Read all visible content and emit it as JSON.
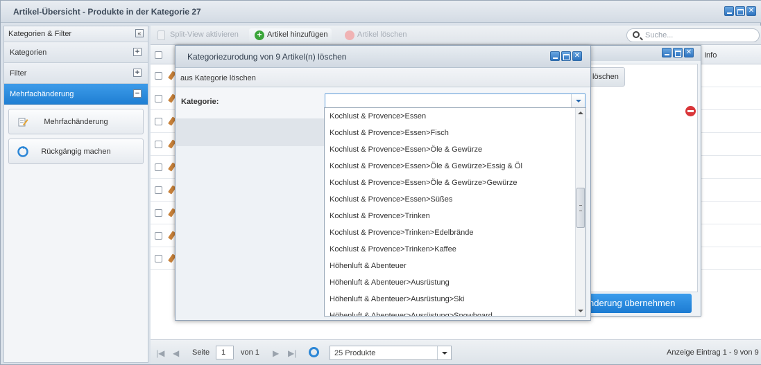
{
  "window": {
    "title": "Artikel-Übersicht - Produkte in der Kategorie 27"
  },
  "sidebar": {
    "header": "Kategorien & Filter",
    "sections": [
      "Kategorien",
      "Filter",
      "Mehrfachänderung"
    ],
    "actions": [
      "Mehrfachänderung",
      "Rückgängig machen"
    ]
  },
  "toolbar": {
    "split_view": "Split-View aktivieren",
    "add": "Artikel hinzufügen",
    "delete": "Artikel löschen",
    "search_placeholder": "Suche..."
  },
  "grid": {
    "col_info": "Info",
    "row_count": 9
  },
  "pager": {
    "page_label": "Seite",
    "page_value": "1",
    "of_label": "von 1",
    "page_size": "25 Produkte",
    "summary": "Anzeige Eintrag 1 - 9 von 9"
  },
  "background_dialog": {
    "loeschen": "löschen",
    "apply": "nderung übernehmen"
  },
  "dialog": {
    "title": "Kategoriezurodung von 9 Artikel(n) löschen",
    "subtitle": "aus Kategorie löschen",
    "field_label": "Kategorie:",
    "field_value": ""
  },
  "dropdown": {
    "items": [
      "Kochlust & Provence>Essen",
      "Kochlust & Provence>Essen>Fisch",
      "Kochlust & Provence>Essen>Öle & Gewürze",
      "Kochlust & Provence>Essen>Öle & Gewürze>Essig & Öl",
      "Kochlust & Provence>Essen>Öle & Gewürze>Gewürze",
      "Kochlust & Provence>Essen>Süßes",
      "Kochlust & Provence>Trinken",
      "Kochlust & Provence>Trinken>Edelbrände",
      "Kochlust & Provence>Trinken>Kaffee",
      "Höhenluft & Abenteuer",
      "Höhenluft & Abenteuer>Ausrüstung",
      "Höhenluft & Abenteuer>Ausrüstung>Ski",
      "Höhenluft & Abenteuer>Ausrüstung>Snowboard"
    ]
  },
  "colors": {
    "accent": "#1f7fd3",
    "danger": "#d9363a"
  }
}
